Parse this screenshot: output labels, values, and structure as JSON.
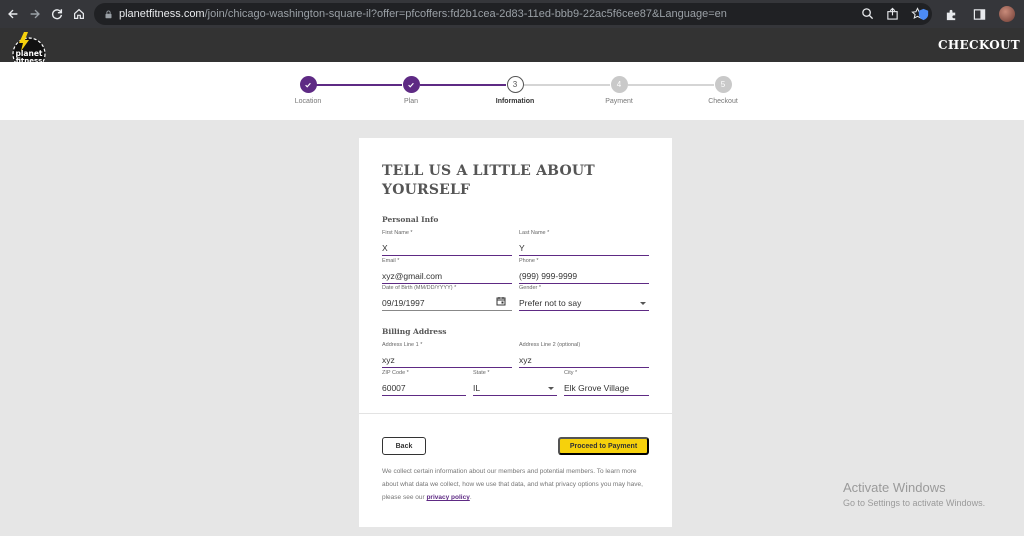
{
  "browser": {
    "url_host": "planetfitness.com",
    "url_path": "/join/chicago-washington-square-il?offer=pfcoffers:fd2b1cea-2d83-11ed-bbb9-22ac5f6cee87&Language=en",
    "icons": [
      "back-icon",
      "forward-icon",
      "reload-icon",
      "home-icon",
      "lock-icon",
      "zoom-icon",
      "share-icon",
      "star-icon",
      "extension-icon",
      "puzzle-icon",
      "sidepanel-icon",
      "profile-avatar"
    ]
  },
  "header": {
    "logo_text": "planet fitness",
    "title": "CHECKOUT"
  },
  "stepper": {
    "steps": [
      {
        "label": "Location",
        "number": "1",
        "state": "done"
      },
      {
        "label": "Plan",
        "number": "2",
        "state": "done"
      },
      {
        "label": "Information",
        "number": "3",
        "state": "current"
      },
      {
        "label": "Payment",
        "number": "4",
        "state": "todo"
      },
      {
        "label": "Checkout",
        "number": "5",
        "state": "todo"
      }
    ]
  },
  "form": {
    "heading": "TELL US A LITTLE ABOUT YOURSELF",
    "personal_title": "Personal Info",
    "first_name": {
      "label": "First Name *",
      "value": "X"
    },
    "last_name": {
      "label": "Last Name *",
      "value": "Y"
    },
    "email": {
      "label": "Email *",
      "value": "xyz@gmail.com"
    },
    "phone": {
      "label": "Phone *",
      "value": "(999) 999-9999"
    },
    "dob": {
      "label": "Date of Birth (MM/DD/YYYY) *",
      "value": "09/19/1997"
    },
    "gender": {
      "label": "Gender *",
      "value": "Prefer not to say"
    },
    "billing_title": "Billing Address",
    "address1": {
      "label": "Address Line 1 *",
      "value": "xyz"
    },
    "address2": {
      "label": "Address Line 2 (optional)",
      "value": "xyz"
    },
    "zip": {
      "label": "ZIP Code *",
      "value": "60007"
    },
    "state": {
      "label": "State *",
      "value": "IL"
    },
    "city": {
      "label": "City *",
      "value": "Elk Grove Village"
    },
    "back_label": "Back",
    "proceed_label": "Proceed to Payment",
    "disclaimer_text": "We collect certain information about our members and potential members. To learn more about what data we collect, how we use that data, and what privacy options you may have, please see our ",
    "privacy_link": "privacy policy",
    "disclaimer_end": "."
  },
  "watermark": {
    "line1": "Activate Windows",
    "line2": "Go to Settings to activate Windows."
  },
  "colors": {
    "brand_purple": "#5e2a84",
    "button_yellow": "#f6d10c",
    "header_dark": "#333333"
  }
}
